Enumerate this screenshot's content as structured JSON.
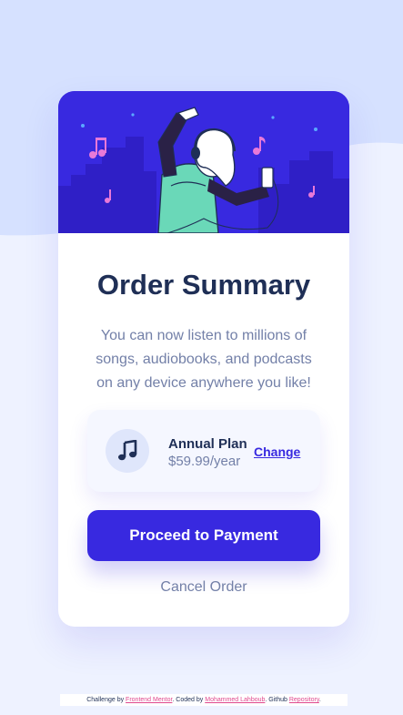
{
  "colors": {
    "page_background": "#eef2ff",
    "wave": "#d6e1ff",
    "hero": "#3829e0",
    "brand": "#3829e0",
    "title": "#1f2f56",
    "muted": "#7380a8",
    "link_pink": "#e0488d"
  },
  "hero": {
    "illustration_icon": "person-listening-music-illustration"
  },
  "card": {
    "title": "Order Summary",
    "description": "You can now listen to millions of songs, audiobooks, and podcasts on any device anywhere you like!",
    "plan": {
      "icon": "music-note-icon",
      "name": "Annual Plan",
      "price": "$59.99/year",
      "change_label": "Change"
    },
    "proceed_label": "Proceed to Payment",
    "cancel_label": "Cancel Order"
  },
  "attribution": {
    "prefix": "Challenge by ",
    "challenge_link": "Frontend Mentor",
    "middle": ". Coded by ",
    "author_link": "Mohammed Lahboub",
    "github_text": ". Github ",
    "repo_link": "Repository",
    "suffix": "."
  }
}
